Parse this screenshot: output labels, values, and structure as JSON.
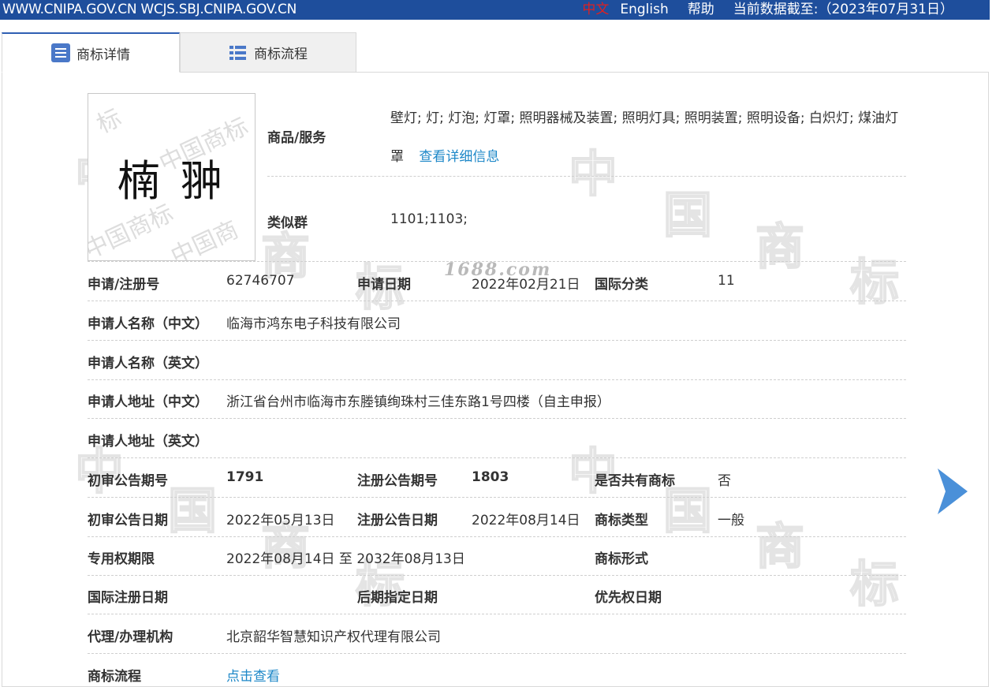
{
  "topbar": {
    "sites": "WWW.CNIPA.GOV.CN WCJS.SBJ.CNIPA.GOV.CN",
    "lang_zh": "中文",
    "lang_en": "English",
    "help": "帮助",
    "data_cutoff": "当前数据截至:（2023年07月31日）"
  },
  "tabs": [
    {
      "label": "商标详情",
      "icon": "list-icon",
      "active": true
    },
    {
      "label": "商标流程",
      "icon": "list-bullet-icon",
      "active": false
    }
  ],
  "mark": {
    "image_text": "楠 翀",
    "watermark": "中国商标"
  },
  "goods": {
    "label": "商品/服务",
    "value_line1": "壁灯; 灯; 灯泡; 灯罩; 照明器械及装置; 照明灯具; 照明装置; 照明设备; 白炽灯; 煤油灯",
    "value_line2": "罩",
    "detail_link": "查看详细信息"
  },
  "similar_group": {
    "label": "类似群",
    "value": "1101;1103;"
  },
  "rows": {
    "reg_no": {
      "label": "申请/注册号",
      "value": "62746707"
    },
    "apply_date": {
      "label": "申请日期",
      "value": "2022年02月21日"
    },
    "intl_class": {
      "label": "国际分类",
      "value": "11"
    },
    "applicant_cn": {
      "label": "申请人名称（中文）",
      "value": "临海市鸿东电子科技有限公司"
    },
    "applicant_en": {
      "label": "申请人名称（英文）",
      "value": ""
    },
    "address_cn": {
      "label": "申请人地址（中文）",
      "value": "浙江省台州市临海市东塍镇绚珠村三佳东路1号四楼（自主申报）"
    },
    "address_en": {
      "label": "申请人地址（英文）",
      "value": ""
    },
    "prelim_no": {
      "label": "初审公告期号",
      "value": "1791"
    },
    "reg_pub_no": {
      "label": "注册公告期号",
      "value": "1803"
    },
    "shared": {
      "label": "是否共有商标",
      "value": "否"
    },
    "prelim_date": {
      "label": "初审公告日期",
      "value": "2022年05月13日"
    },
    "reg_pub_date": {
      "label": "注册公告日期",
      "value": "2022年08月14日"
    },
    "mark_type": {
      "label": "商标类型",
      "value": "一般"
    },
    "exclusive_term": {
      "label": "专用权期限",
      "value": "2022年08月14日 至 2032年08月13日"
    },
    "mark_form": {
      "label": "商标形式",
      "value": ""
    },
    "intl_reg_date": {
      "label": "国际注册日期",
      "value": ""
    },
    "later_date": {
      "label": "后期指定日期",
      "value": ""
    },
    "priority_date": {
      "label": "优先权日期",
      "value": ""
    },
    "agent": {
      "label": "代理/办理机构",
      "value": "北京韶华智慧知识产权代理有限公司"
    },
    "process": {
      "label": "商标流程",
      "value": "点击查看"
    }
  },
  "overlay_watermark": "1688.com",
  "colors": {
    "topbar": "#1e4e9c",
    "link": "#1e88c8",
    "arrow": "#4a90d9",
    "lang_active": "#e02020"
  }
}
